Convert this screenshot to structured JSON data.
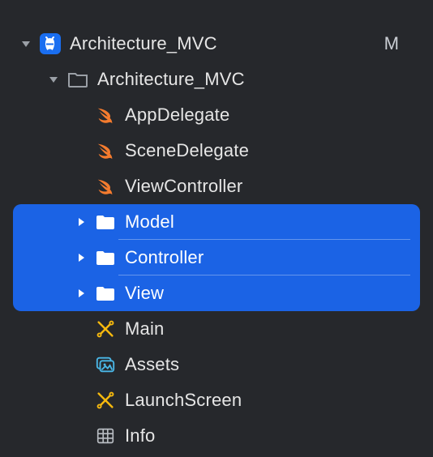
{
  "tree": {
    "root": {
      "label": "Architecture_MVC",
      "status": "M",
      "children": [
        {
          "label": "Architecture_MVC",
          "children": [
            {
              "label": "AppDelegate",
              "kind": "swift"
            },
            {
              "label": "SceneDelegate",
              "kind": "swift"
            },
            {
              "label": "ViewController",
              "kind": "swift"
            },
            {
              "label": "Model",
              "kind": "folder",
              "selected": true
            },
            {
              "label": "Controller",
              "kind": "folder",
              "selected": true
            },
            {
              "label": "View",
              "kind": "folder",
              "selected": true
            },
            {
              "label": "Main",
              "kind": "storyboard"
            },
            {
              "label": "Assets",
              "kind": "assets"
            },
            {
              "label": "LaunchScreen",
              "kind": "storyboard"
            },
            {
              "label": "Info",
              "kind": "plist"
            }
          ]
        }
      ]
    }
  },
  "colors": {
    "selection": "#1B63E5",
    "background": "#26282C",
    "swift": "#F47B2E",
    "storyboard": "#F6B90E",
    "assets": "#4AB8E8",
    "plist": "#B8BCC2",
    "folder_closed": "#FFFFFF",
    "folder_open": "#9A9FA6",
    "app": "#1A6EF0"
  }
}
